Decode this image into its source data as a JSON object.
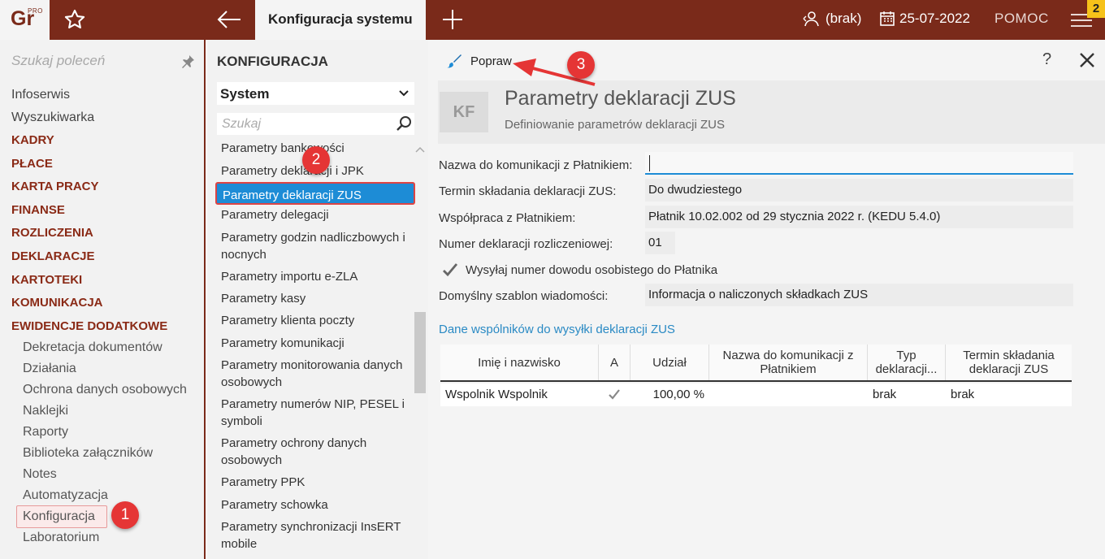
{
  "topbar": {
    "logo": "Gr",
    "logo_pro": "PRO",
    "active_tab": "Konfiguracja systemu",
    "user": "(brak)",
    "date": "25-07-2022",
    "help": "POMOC",
    "badge": "2"
  },
  "sidebar": {
    "search_placeholder": "Szukaj poleceń",
    "items": [
      {
        "label": "Infoserwis",
        "type": "link"
      },
      {
        "label": "Wyszukiwarka",
        "type": "link"
      },
      {
        "label": "KADRY",
        "type": "section"
      },
      {
        "label": "PŁACE",
        "type": "section"
      },
      {
        "label": "KARTA PRACY",
        "type": "section"
      },
      {
        "label": "FINANSE",
        "type": "section"
      },
      {
        "label": "ROZLICZENIA",
        "type": "section"
      },
      {
        "label": "DEKLARACJE",
        "type": "section"
      },
      {
        "label": "KARTOTEKI",
        "type": "section"
      },
      {
        "label": "KOMUNIKACJA",
        "type": "section"
      },
      {
        "label": "EWIDENCJE DODATKOWE",
        "type": "section"
      }
    ],
    "subitems": [
      "Dekretacja dokumentów",
      "Działania",
      "Ochrona danych osobowych",
      "Naklejki",
      "Raporty",
      "Biblioteka załączników",
      "Notes",
      "Automatyzacja",
      "Konfiguracja",
      "Laboratorium"
    ]
  },
  "midpanel": {
    "title": "KONFIGURACJA",
    "select": "System",
    "search_placeholder": "Szukaj",
    "items": [
      "Parametry bankowości",
      "Parametry deklaracji i JPK",
      "Parametry deklaracji ZUS",
      "Parametry delegacji",
      "Parametry godzin nadliczbowych i nocnych",
      "Parametry importu e-ZLA",
      "Parametry kasy",
      "Parametry klienta poczty",
      "Parametry komunikacji",
      "Parametry monitorowania danych osobowych",
      "Parametry numerów NIP, PESEL i symboli",
      "Parametry ochrony danych osobowych",
      "Parametry PPK",
      "Parametry schowka",
      "Parametry synchronizacji InsERT mobile"
    ]
  },
  "content": {
    "edit_label": "Popraw",
    "help": "?",
    "header": {
      "badge": "KF",
      "title": "Parametry deklaracji ZUS",
      "subtitle": "Definiowanie parametrów deklaracji ZUS"
    },
    "fields": {
      "name_label": "Nazwa do komunikacji z Płatnikiem:",
      "name_value": "",
      "term_label": "Termin składania deklaracji ZUS:",
      "term_value": "Do dwudziestego",
      "coop_label": "Współpraca z Płatnikiem:",
      "coop_value": "Płatnik 10.02.002 od 29 stycznia 2022 r. (KEDU 5.4.0)",
      "num_label": "Numer deklaracji rozliczeniowej:",
      "num_value": "01",
      "checkbox_label": "Wysyłaj numer dowodu osobistego do Płatnika",
      "checkbox_checked": true,
      "template_label": "Domyślny szablon wiadomości:",
      "template_value": "Informacja o naliczonych składkach ZUS"
    },
    "partners": {
      "section_title": "Dane wspólników do wysyłki deklaracji ZUS",
      "columns": [
        "Imię i nazwisko",
        "A",
        "Udział",
        "Nazwa do komunikacji z Płatnikiem",
        "Typ deklaracji...",
        "Termin składania deklaracji ZUS"
      ],
      "rows": [
        {
          "name": "Wspolnik Wspolnik",
          "a_checked": true,
          "share": "100,00 %",
          "comm_name": "",
          "type": "brak",
          "term": "brak"
        }
      ]
    }
  },
  "annotations": [
    "1",
    "2",
    "3"
  ],
  "colors": {
    "brand": "#7a2a1a",
    "accent": "#1d8cd6",
    "section": "#8a2a16",
    "marker": "#e53535",
    "badge": "#f6c21a"
  }
}
